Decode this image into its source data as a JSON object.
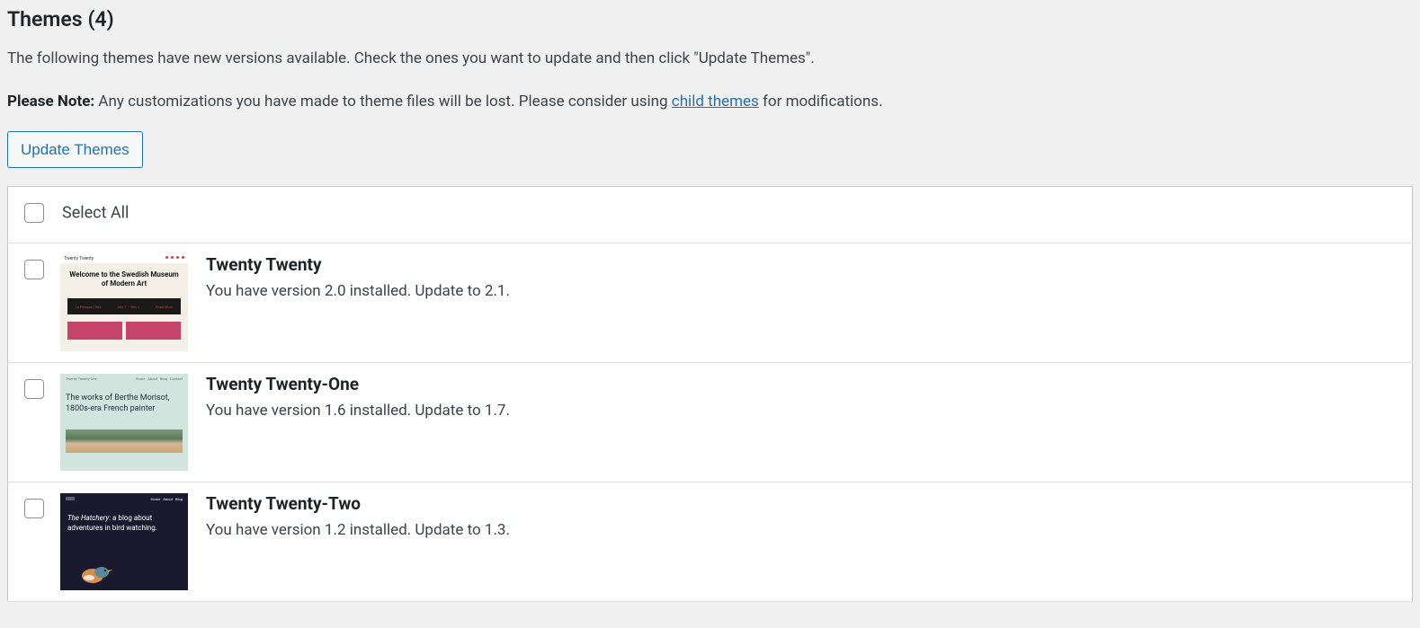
{
  "header": {
    "title_prefix": "Themes",
    "title_count": "(4)",
    "intro": "The following themes have new versions available. Check the ones you want to update and then click \"Update Themes\".",
    "note_label": "Please Note:",
    "note_text_1": " Any customizations you have made to theme files will be lost. Please consider using ",
    "note_link_text": "child themes",
    "note_text_2": " for modifications."
  },
  "buttons": {
    "update": "Update Themes"
  },
  "table": {
    "select_all": "Select All"
  },
  "themes": [
    {
      "name": "Twenty Twenty",
      "version_text": "You have version 2.0 installed. Update to 2.1.",
      "thumb": {
        "welcome_line": "Welcome to the Swedish Museum of Modern Art"
      }
    },
    {
      "name": "Twenty Twenty-One",
      "version_text": "You have version 1.6 installed. Update to 1.7.",
      "thumb": {
        "headline": "The works of Berthe Morisot, 1800s-era French painter"
      }
    },
    {
      "name": "Twenty Twenty-Two",
      "version_text": "You have version 1.2 installed. Update to 1.3.",
      "thumb": {
        "headline_italic": "The Hatchery",
        "headline_rest": ": a blog about adventures in bird watching."
      }
    }
  ]
}
